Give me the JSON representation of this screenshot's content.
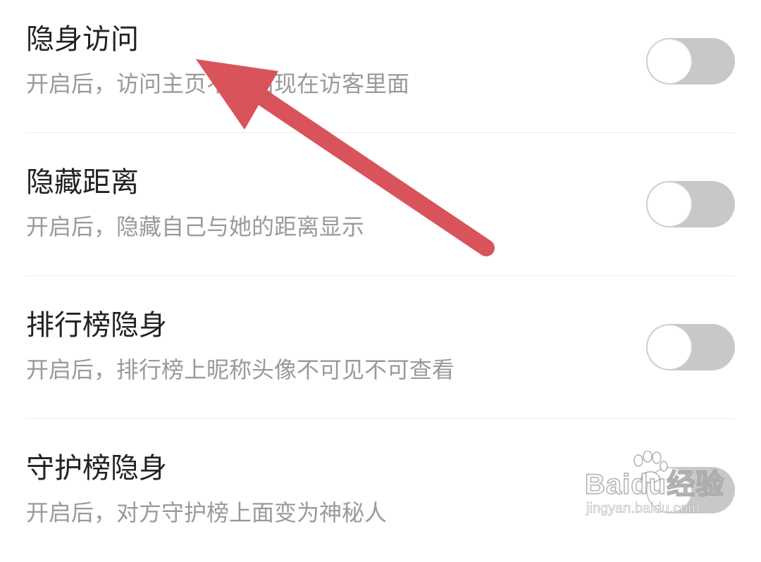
{
  "settings": [
    {
      "title": "隐身访问",
      "description": "开启后，访问主页不会出现在访客里面",
      "enabled": false
    },
    {
      "title": "隐藏距离",
      "description": "开启后，隐藏自己与她的距离显示",
      "enabled": false
    },
    {
      "title": "排行榜隐身",
      "description": "开启后，排行榜上昵称头像不可见不可查看",
      "enabled": false
    },
    {
      "title": "守护榜隐身",
      "description": "开启后，对方守护榜上面变为神秘人",
      "enabled": false
    }
  ],
  "watermark": {
    "brand": "Baidu经验",
    "domain": "jingyan.baidu.com"
  },
  "colors": {
    "toggle_off_track": "#c8c8c8",
    "toggle_knob": "#ffffff",
    "title_text": "#222222",
    "description_text": "#9a9a9a",
    "annotation_arrow": "#d9535b"
  },
  "icons": {
    "annotation": "arrow-pointer-icon",
    "watermark_logo": "paw-print-icon"
  }
}
